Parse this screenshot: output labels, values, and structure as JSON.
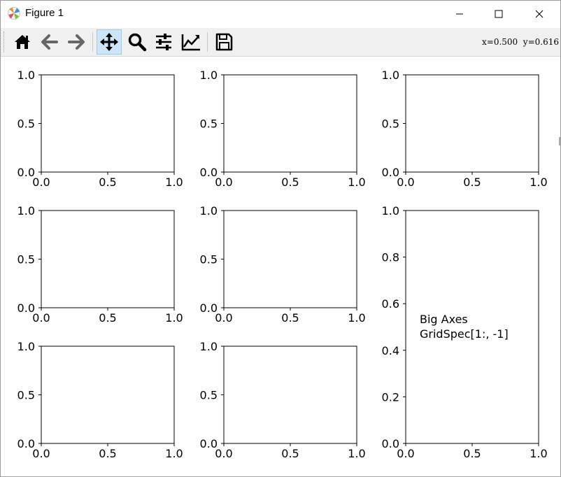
{
  "window": {
    "title": "Figure 1"
  },
  "toolbar": {
    "tools": [
      "home-icon",
      "back-arrow-icon",
      "forward-arrow-icon",
      "pan-icon",
      "zoom-icon",
      "configure-subplots-icon",
      "edit-axes-icon",
      "save-icon"
    ],
    "active_tool": "pan-icon",
    "coords": "x=0.500  y=0.616"
  },
  "figure": {
    "small_axes": [
      {
        "row": 0,
        "col": 0
      },
      {
        "row": 0,
        "col": 1
      },
      {
        "row": 0,
        "col": 2
      },
      {
        "row": 1,
        "col": 0
      },
      {
        "row": 1,
        "col": 1
      },
      {
        "row": 2,
        "col": 0
      },
      {
        "row": 2,
        "col": 1
      }
    ],
    "big_axes_text": [
      "Big Axes",
      "GridSpec[1:, -1]"
    ]
  },
  "chart_data": [
    {
      "type": "scatter",
      "title": "",
      "xlabel": "",
      "ylabel": "",
      "xlim": [
        0,
        1
      ],
      "ylim": [
        0,
        1
      ],
      "xticks": [
        "0.0",
        "0.5",
        "1.0"
      ],
      "yticks": [
        "0.0",
        "0.5",
        "1.0"
      ],
      "series": []
    },
    {
      "type": "scatter",
      "title": "",
      "xlabel": "",
      "ylabel": "",
      "xlim": [
        0,
        1
      ],
      "ylim": [
        0,
        1
      ],
      "xticks": [
        "0.0",
        "0.5",
        "1.0"
      ],
      "yticks": [
        "0.0",
        "0.5",
        "1.0"
      ],
      "series": []
    },
    {
      "type": "scatter",
      "title": "",
      "xlabel": "",
      "ylabel": "",
      "xlim": [
        0,
        1
      ],
      "ylim": [
        0,
        1
      ],
      "xticks": [
        "0.0",
        "0.5",
        "1.0"
      ],
      "yticks": [
        "0.0",
        "0.5",
        "1.0"
      ],
      "series": []
    },
    {
      "type": "scatter",
      "title": "",
      "xlabel": "",
      "ylabel": "",
      "xlim": [
        0,
        1
      ],
      "ylim": [
        0,
        1
      ],
      "xticks": [
        "0.0",
        "0.5",
        "1.0"
      ],
      "yticks": [
        "0.0",
        "0.5",
        "1.0"
      ],
      "series": []
    },
    {
      "type": "scatter",
      "title": "",
      "xlabel": "",
      "ylabel": "",
      "xlim": [
        0,
        1
      ],
      "ylim": [
        0,
        1
      ],
      "xticks": [
        "0.0",
        "0.5",
        "1.0"
      ],
      "yticks": [
        "0.0",
        "0.5",
        "1.0"
      ],
      "series": []
    },
    {
      "type": "scatter",
      "title": "",
      "xlabel": "",
      "ylabel": "",
      "xlim": [
        0,
        1
      ],
      "ylim": [
        0,
        1
      ],
      "xticks": [
        "0.0",
        "0.5",
        "1.0"
      ],
      "yticks": [
        "0.0",
        "0.5",
        "1.0"
      ],
      "series": []
    },
    {
      "type": "scatter",
      "title": "",
      "xlabel": "",
      "ylabel": "",
      "xlim": [
        0,
        1
      ],
      "ylim": [
        0,
        1
      ],
      "xticks": [
        "0.0",
        "0.5",
        "1.0"
      ],
      "yticks": [
        "0.0",
        "0.5",
        "1.0"
      ],
      "series": []
    },
    {
      "type": "scatter",
      "title": "",
      "xlabel": "",
      "ylabel": "",
      "xlim": [
        0,
        1
      ],
      "ylim": [
        0,
        1
      ],
      "xticks": [
        "0.0",
        "0.5",
        "1.0"
      ],
      "yticks": [
        "0.0",
        "0.2",
        "0.4",
        "0.6",
        "0.8",
        "1.0"
      ],
      "series": [],
      "annotations": [
        "Big Axes",
        "GridSpec[1:, -1]"
      ]
    }
  ]
}
